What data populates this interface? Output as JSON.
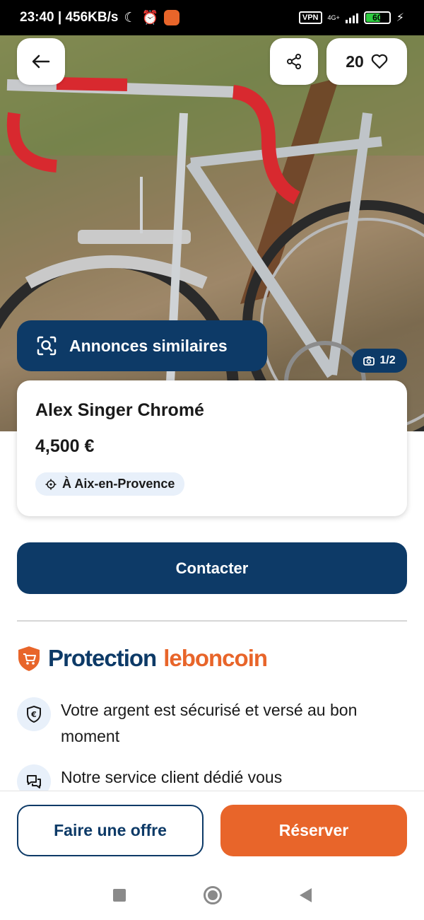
{
  "status_bar": {
    "time_speed": "23:40 | 456KB/s",
    "vpn": "VPN",
    "network": "4G+",
    "battery": "60"
  },
  "header": {
    "favorites_count": "20"
  },
  "hero": {
    "similar_label": "Annonces similaires",
    "photo_counter": "1/2"
  },
  "listing": {
    "title": "Alex Singer Chromé",
    "price": "4,500 €",
    "location": "À Aix-en-Provence"
  },
  "actions": {
    "contact_label": "Contacter",
    "offer_label": "Faire une offre",
    "reserve_label": "Réserver"
  },
  "protection": {
    "title_part1": "Protection",
    "title_part2": "leboncoin",
    "benefits": [
      {
        "text": "Votre argent est sécurisé et versé au bon moment"
      },
      {
        "text": "Notre service client dédié vous"
      }
    ]
  },
  "colors": {
    "primary": "#0d3a67",
    "accent": "#e8652a"
  }
}
